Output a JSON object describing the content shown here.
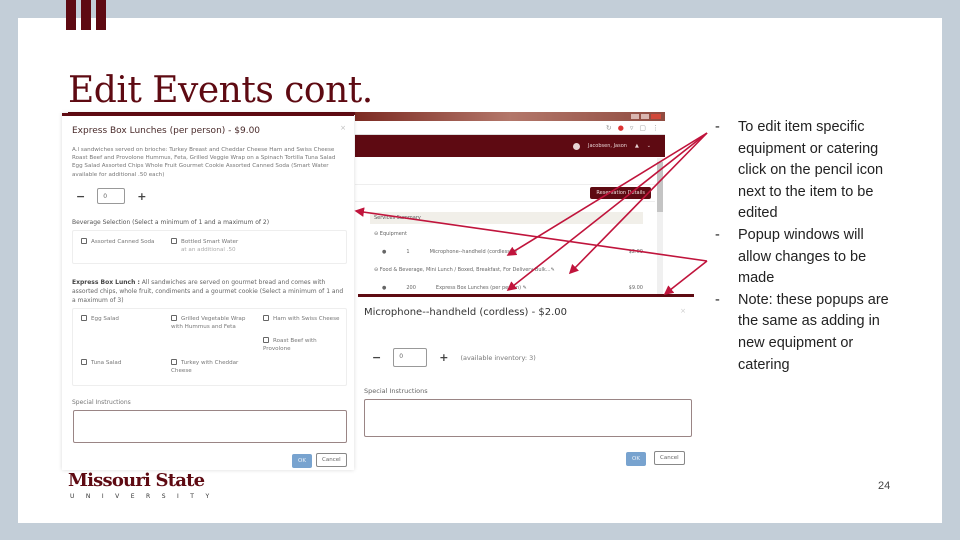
{
  "slide": {
    "title": "Edit Events cont.",
    "page_number": "24",
    "accent_color": "#5e0a12",
    "bullets": [
      "To edit item specific equipment or catering click on the pencil icon next to the item to be edited",
      "Popup windows will allow changes to be made",
      "Note: these popups are the same as adding in new equipment or catering"
    ],
    "logo": {
      "name": "Missouri State",
      "sub": "UNIVERSITY"
    }
  },
  "browser": {
    "user_name": "Jacobsen, Jason",
    "reservation_details_label": "Reservation Details",
    "services_summary_label": "Services Summary",
    "equipment_label": "Equipment",
    "equipment_row": {
      "qty": "1",
      "item": "Microphone--handheld (cordless)",
      "price": "$2.00"
    },
    "food_label": "Food & Beverage, Mini Lunch / Boxed, Breakfast, For Delivery Bulk...",
    "food_row": {
      "qty": "200",
      "item": "Express Box Lunches (per person)",
      "price": "$9.00"
    }
  },
  "express_modal": {
    "title": "Express Box Lunches (per person) - $9.00",
    "description": "A.l sandwiches served on brioche: Turkey Breast and Cheddar Cheese Ham and Swiss Cheese Roast Beef and Provolone Hummus, Feta, Grilled Veggie Wrap on a Spinach Tortilla Tuna Salad Egg Salad Assorted Chips Whole Fruit Gourmet Cookie Assorted Canned Soda (Smart Water available for additional .50 each)",
    "quantity": "0",
    "beverage_label": "Beverage Selection (Select a minimum of 1 and a maximum of 2)",
    "beverage_options": [
      {
        "label": "Assorted Canned Soda",
        "sub": ""
      },
      {
        "label": "Bottled Smart Water",
        "sub": "at an additional .50"
      }
    ],
    "lunch_label_prefix": "Express Box Lunch :",
    "lunch_label": "All sandwiches are served on gourmet bread and comes with assorted chips, whole fruit, condiments and a gourmet cookie (Select a minimum of 1 and a maximum of 3)",
    "lunch_options": [
      "Egg Salad",
      "Grilled Vegetable Wrap with Hummus and Feta",
      "Ham with Swiss Cheese",
      "Roast Beef with Provolone",
      "Tuna Salad",
      "Turkey with Cheddar Cheese"
    ],
    "special_instructions_label": "Special Instructions",
    "special_instructions_value": "",
    "ok_label": "OK",
    "cancel_label": "Cancel"
  },
  "mic_modal": {
    "title": "Microphone--handheld (cordless) - $2.00",
    "quantity": "0",
    "available_inventory": "(available inventory: 3)",
    "special_instructions_label": "Special Instructions",
    "special_instructions_value": "",
    "ok_label": "OK",
    "cancel_label": "Cancel"
  },
  "icons": {
    "minus": "−",
    "plus": "+",
    "close": "×",
    "pencil": "✎"
  }
}
